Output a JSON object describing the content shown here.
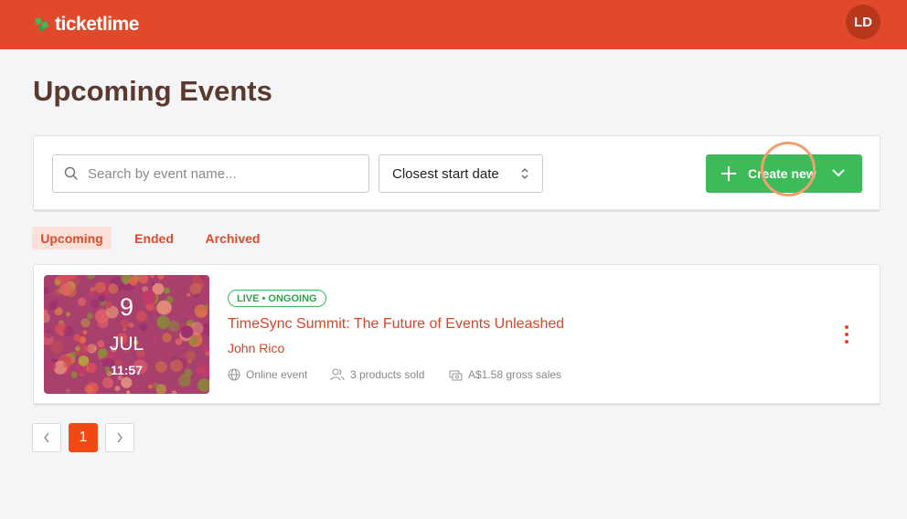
{
  "header": {
    "logo_text": "ticketlime",
    "avatar_initials": "LD"
  },
  "page": {
    "title": "Upcoming Events"
  },
  "toolbar": {
    "search_placeholder": "Search by event name...",
    "search_value": "",
    "sort_selected": "Closest start date",
    "create_label": "Create new"
  },
  "tabs": [
    {
      "label": "Upcoming",
      "active": true
    },
    {
      "label": "Ended",
      "active": false
    },
    {
      "label": "Archived",
      "active": false
    }
  ],
  "events": [
    {
      "day": "9",
      "month": "JUL",
      "time": "11:57",
      "status": "LIVE • ONGOING",
      "title": "TimeSync Summit: The Future of Events Unleashed",
      "organizer": "John Rico",
      "location": "Online event",
      "products_sold": "3 products sold",
      "gross_sales": "A$1.58 gross sales"
    }
  ],
  "pagination": {
    "current": "1",
    "prev_icon": "chevron-left-icon",
    "next_icon": "chevron-right-icon"
  },
  "colors": {
    "brand": "#e04a2a",
    "create_button": "#3dbb5a",
    "pagination_active": "#f04a12",
    "title_text": "#5b3a2e"
  }
}
